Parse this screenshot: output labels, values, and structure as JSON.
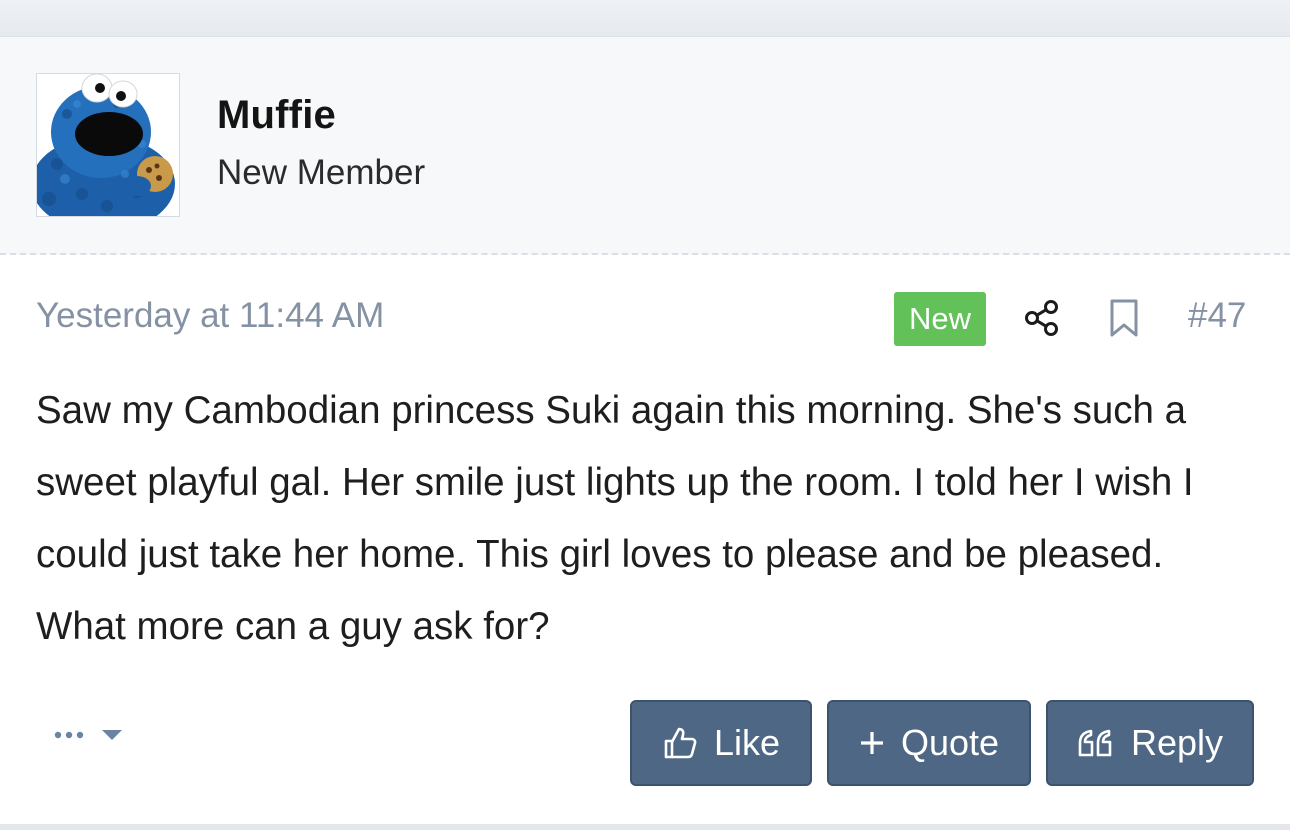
{
  "user": {
    "name": "Muffie",
    "title": "New Member",
    "avatar_icon": "cookie-monster-avatar"
  },
  "post": {
    "date": "Yesterday at 11:44 AM",
    "badge": "New",
    "number": "#47",
    "body": "Saw my Cambodian princess Suki again this morning. She's such a sweet playful gal. Her smile just lights up the room. I told her I wish I could just take her home. This girl loves to please and be pleased. What more can a guy ask for?"
  },
  "actions": {
    "more_icon": "ellipsis-dropdown",
    "like_label": "Like",
    "quote_label": "Quote",
    "reply_label": "Reply"
  },
  "colors": {
    "badge_green": "#63c15a",
    "button_blue": "#4e6784",
    "meta_gray": "#8592a3"
  }
}
